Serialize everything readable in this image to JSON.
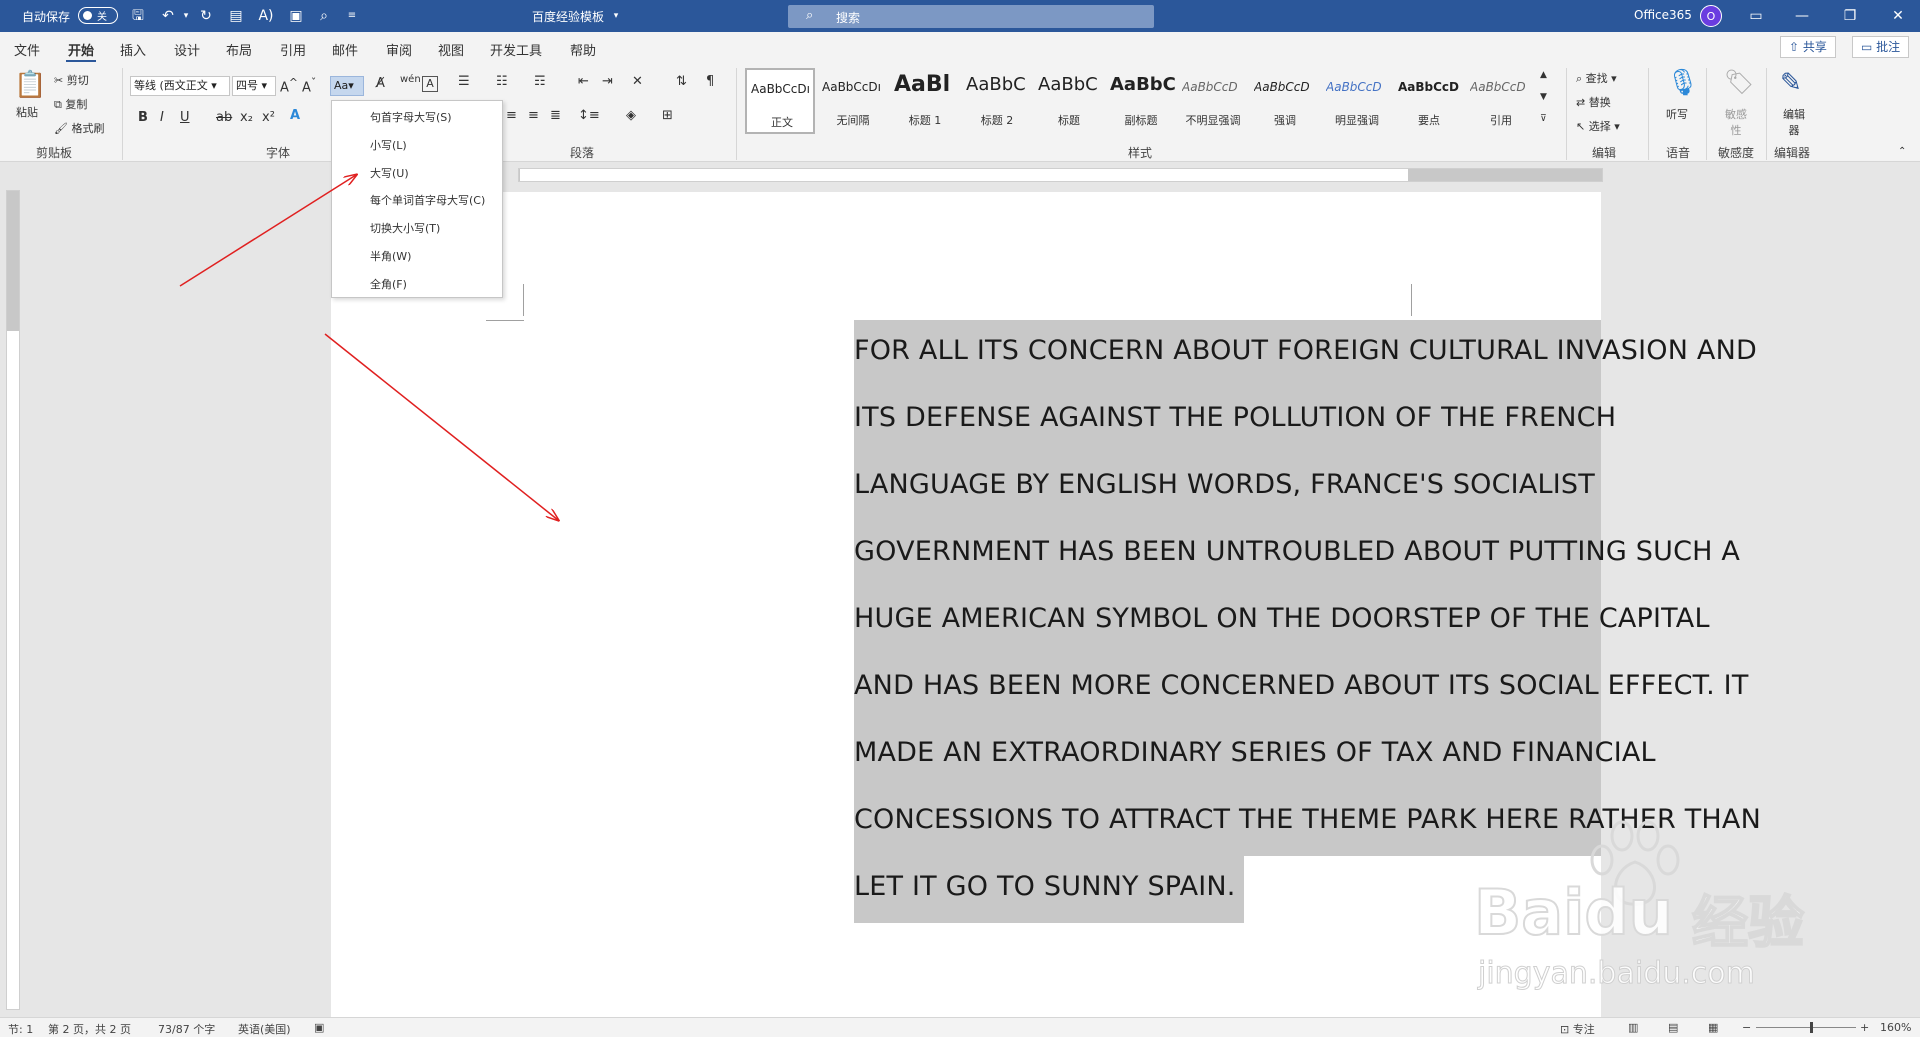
{
  "titlebar": {
    "autosave_label": "自动保存",
    "autosave_state": "关",
    "doc_title": "百度经验模板",
    "search_placeholder": "搜索",
    "account": "Office365",
    "avatar_letter": "O"
  },
  "tabs": [
    "文件",
    "开始",
    "插入",
    "设计",
    "布局",
    "引用",
    "邮件",
    "审阅",
    "视图",
    "开发工具",
    "帮助"
  ],
  "actions": {
    "share": "共享",
    "comment": "批注"
  },
  "ribbon": {
    "clipboard": {
      "paste": "粘贴",
      "cut": "剪切",
      "copy": "复制",
      "format_painter": "格式刷",
      "label": "剪贴板"
    },
    "font": {
      "font_name": "等线 (西文正文",
      "font_size": "四号",
      "label": "字体",
      "change_case": "Aa"
    },
    "paragraph": {
      "label": "段落"
    },
    "styles": {
      "label": "样式",
      "items": [
        {
          "sample": "AaBbCcDı",
          "name": "正文"
        },
        {
          "sample": "AaBbCcDı",
          "name": "无间隔"
        },
        {
          "sample": "AaBl",
          "name": "标题 1"
        },
        {
          "sample": "AaBbC",
          "name": "标题 2"
        },
        {
          "sample": "AaBbC",
          "name": "标题"
        },
        {
          "sample": "AaBbC",
          "name": "副标题"
        },
        {
          "sample": "AaBbCcD",
          "name": "不明显强调"
        },
        {
          "sample": "AaBbCcD",
          "name": "强调"
        },
        {
          "sample": "AaBbCcD",
          "name": "明显强调"
        },
        {
          "sample": "AaBbCcD",
          "name": "要点"
        },
        {
          "sample": "AaBbCcD",
          "name": "引用"
        }
      ]
    },
    "editing": {
      "find": "查找",
      "replace": "替换",
      "select": "选择",
      "label": "编辑"
    },
    "voice": {
      "dictate": "听写",
      "label": "语音"
    },
    "sensitivity": {
      "button": "敏感性",
      "label": "敏感度"
    },
    "editor": {
      "button": "编辑器",
      "label": "编辑器"
    }
  },
  "case_menu": {
    "items": [
      "句首字母大写(S)",
      "小写(L)",
      "大写(U)",
      "每个单词首字母大写(C)",
      "切换大小写(T)",
      "半角(W)",
      "全角(F)"
    ]
  },
  "document": {
    "lines": [
      "FOR ALL ITS CONCERN ABOUT FOREIGN CULTURAL INVASION AND",
      "ITS DEFENSE AGAINST THE POLLUTION OF THE FRENCH",
      "LANGUAGE BY ENGLISH WORDS, FRANCE'S SOCIALIST",
      "GOVERNMENT HAS BEEN UNTROUBLED ABOUT PUTTING SUCH A",
      "HUGE AMERICAN SYMBOL ON THE DOORSTEP OF THE CAPITAL",
      "AND HAS BEEN MORE CONCERNED ABOUT ITS SOCIAL EFFECT. IT",
      "MADE AN EXTRAORDINARY SERIES OF TAX AND FINANCIAL",
      "CONCESSIONS TO ATTRACT THE THEME PARK HERE RATHER THAN",
      "LET IT GO TO SUNNY SPAIN."
    ]
  },
  "statusbar": {
    "section": "节: 1",
    "page": "第 2 页，共 2 页",
    "words": "73/87 个字",
    "language": "英语(美国)",
    "focus": "专注",
    "zoom": "160%"
  },
  "watermark": {
    "brand": "Baidu",
    "cn": "经验",
    "url": "jingyan.baidu.com"
  },
  "colors": {
    "accent": "#2b579a",
    "highlight": "#c8c8c8",
    "arrow": "#e02020"
  }
}
